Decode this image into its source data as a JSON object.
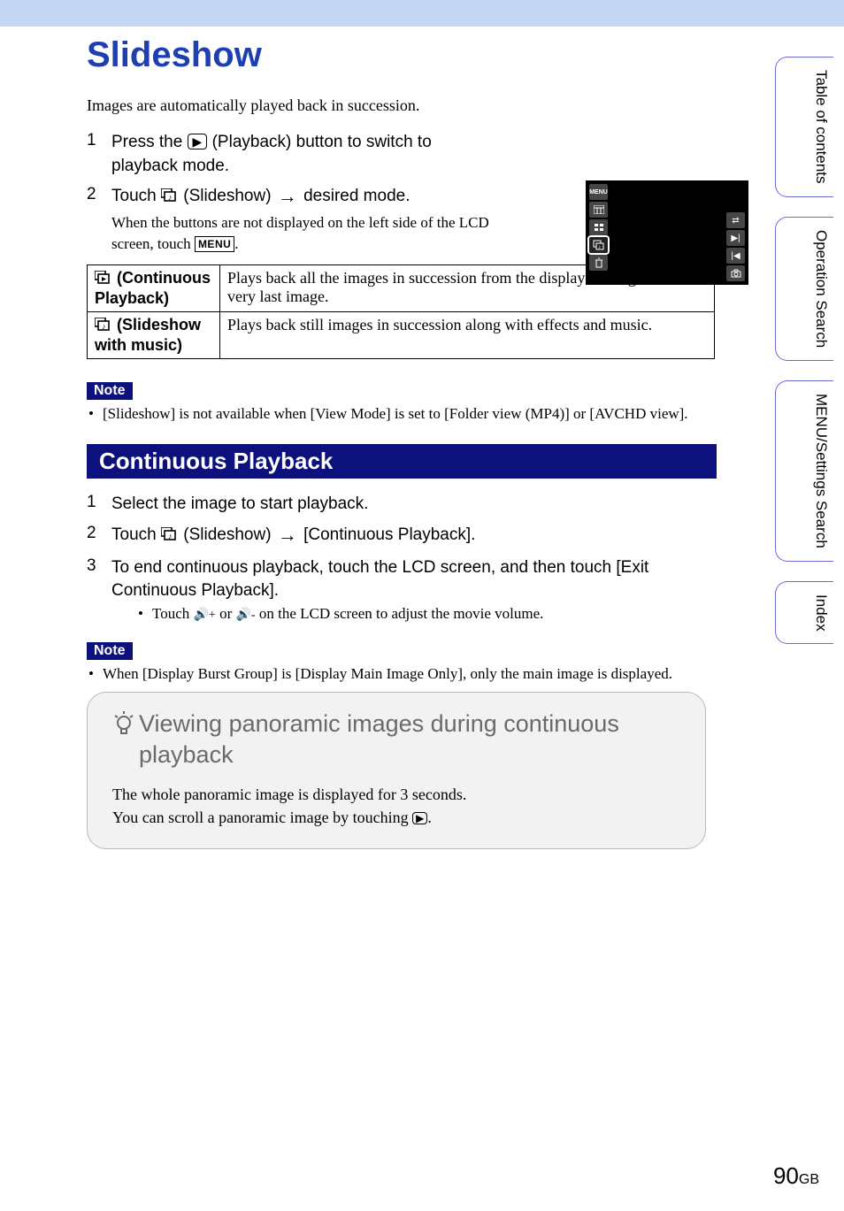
{
  "title": "Slideshow",
  "intro": "Images are automatically played back in succession.",
  "steps_top": [
    {
      "num": "1",
      "pre": "Press the ",
      "post": " (Playback) button to switch to playback mode."
    },
    {
      "num": "2",
      "title_pre": "Touch ",
      "title_mid": " (Slideshow) ",
      "title_post": " desired mode.",
      "sub_pre": "When the buttons are not displayed on the left side of the LCD screen, touch ",
      "sub_post": "."
    }
  ],
  "table": {
    "row1_label": " (Continuous Playback)",
    "row1_desc": "Plays back all the images in succession from the displayed image to the very last image.",
    "row2_label": " (Slideshow with music)",
    "row2_desc": "Plays back still images in succession along with effects and music."
  },
  "note_label": "Note",
  "note1": "[Slideshow] is not available when [View Mode] is set to [Folder view (MP4)] or [AVCHD view].",
  "section": "Continuous Playback",
  "steps_bottom": {
    "s1": {
      "num": "1",
      "text": "Select the image to start playback."
    },
    "s2": {
      "num": "2",
      "pre": "Touch ",
      "mid": " (Slideshow) ",
      "post": " [Continuous Playback]."
    },
    "s3": {
      "num": "3",
      "text": "To end continuous playback, touch the LCD screen, and then touch [Exit Continuous Playback].",
      "sub_pre": "Touch ",
      "sub_mid": " or ",
      "sub_post": " on the LCD screen to adjust the movie volume."
    }
  },
  "note2": "When [Display Burst Group] is [Display Main Image Only], only the main image is displayed.",
  "tip": {
    "title": "Viewing panoramic images during continuous playback",
    "body_line1": "The whole panoramic image is displayed for 3 seconds.",
    "body_line2_pre": "You can scroll a panoramic image by touching ",
    "body_line2_post": "."
  },
  "tabs": {
    "toc": "Table of contents",
    "op": "Operation Search",
    "menu": "MENU/Settings Search",
    "index": "Index"
  },
  "lcd": {
    "menu": "MENU"
  },
  "page": {
    "num": "90",
    "suffix": "GB"
  }
}
